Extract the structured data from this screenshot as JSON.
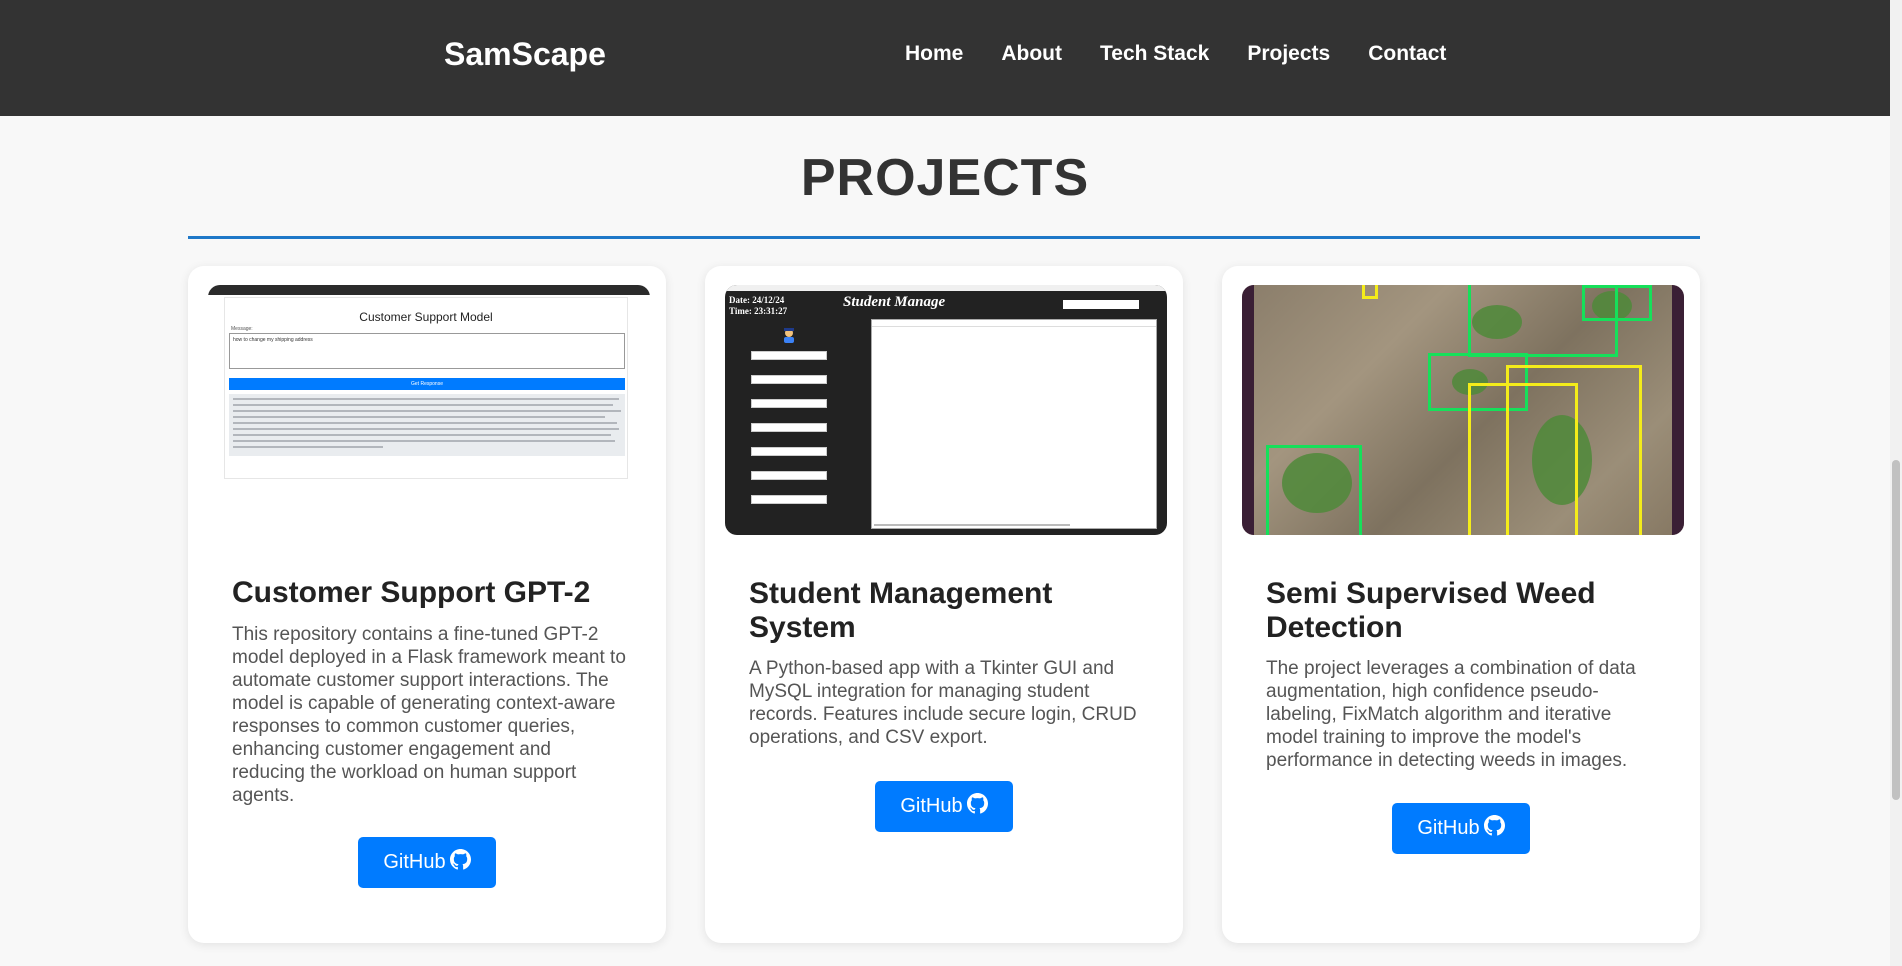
{
  "navbar": {
    "brand": "SamScape",
    "links": [
      "Home",
      "About",
      "Tech Stack",
      "Projects",
      "Contact"
    ]
  },
  "section": {
    "title": "PROJECTS"
  },
  "projects": [
    {
      "title": "Customer Support GPT-2",
      "description": "This repository contains a fine-tuned GPT-2 model deployed in a Flask framework meant to automate customer support interactions. The model is capable of generating context-aware responses to common customer queries, enhancing customer engagement and reducing the workload on human support agents.",
      "button_label": "GitHub",
      "image": {
        "heading": "Customer Support Model",
        "input_text": "how to change my shipping address",
        "button": "Get Response"
      }
    },
    {
      "title": "Student Management System",
      "description": "A Python-based app with a Tkinter GUI and MySQL integration for managing student records. Features include secure login, CRUD operations, and CSV export.",
      "button_label": "GitHub",
      "image": {
        "date": "Date: 24/12/24",
        "time": "Time: 23:31:27",
        "heading": "Student Manage"
      }
    },
    {
      "title": "Semi Supervised Weed Detection",
      "description": "The project leverages a combination of data augmentation, high confidence pseudo-labeling, FixMatch algorithm and iterative model training to improve the model's performance in detecting weeds in images.",
      "button_label": "GitHub"
    }
  ],
  "colors": {
    "navbar_bg": "#333333",
    "accent": "#007bff",
    "rule": "#1f78c8",
    "page_bg": "#f8f8f8"
  },
  "icons": {
    "github": "github-icon"
  }
}
